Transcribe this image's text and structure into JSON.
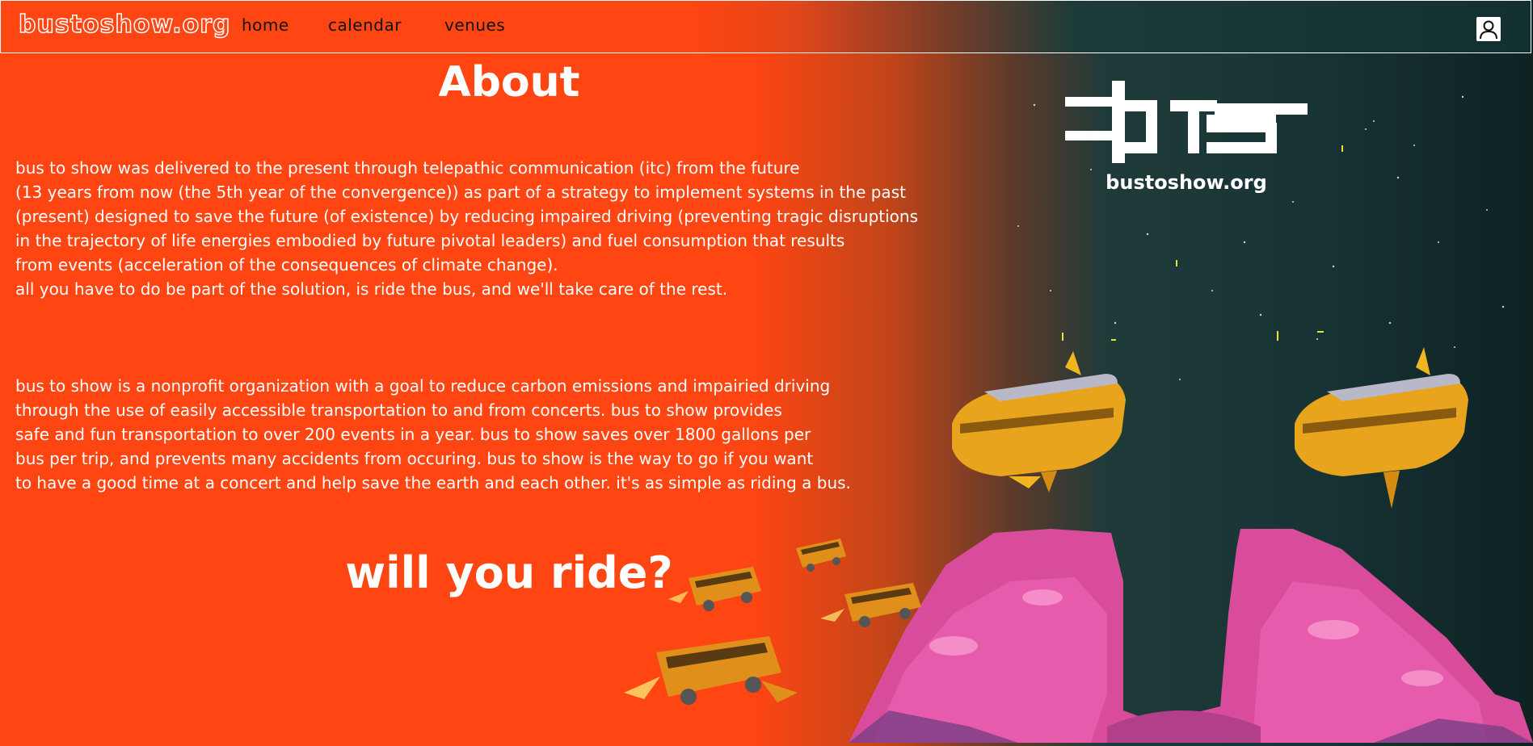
{
  "nav": {
    "brand": "bustoshow.org",
    "links": [
      "home",
      "calendar",
      "venues"
    ]
  },
  "main": {
    "title": "About",
    "paragraph1": [
      "bus to show was delivered to the present through telepathic communication (itc) from the future",
      "(13 years from now (the 5th year of the convergence)) as part of a strategy to implement systems in the past",
      "(present) designed to save the future (of existence) by reducing impaired driving (preventing tragic disruptions",
      "in the trajectory of life energies embodied by future pivotal leaders) and fuel consumption that results",
      "from events (acceleration of the consequences of climate change).",
      "all you have to do be part of the solution, is ride the bus, and we'll take care of the rest."
    ],
    "paragraph2": [
      "bus to show is a nonprofit organization with a goal to reduce carbon emissions and impairied driving",
      "through the use of easily accessible transportation to and from concerts. bus to show provides",
      "safe and fun transportation to over 200 events in a year. bus to show saves over 1800 gallons per",
      "bus per trip, and prevents many accidents from occuring. bus to show is the way to go if you want",
      "to have a good time at a concert and help save the earth and each other. it's as simple as riding a bus."
    ],
    "cta": "will you ride?"
  },
  "logo": {
    "url_text": "bustoshow.org"
  },
  "colors": {
    "accent": "#ff4512",
    "space": "#173334",
    "text": "#ffffff"
  },
  "icons": [
    "user-icon",
    "bts-logo",
    "spaceship-bus",
    "flying-bus",
    "pink-rock"
  ]
}
